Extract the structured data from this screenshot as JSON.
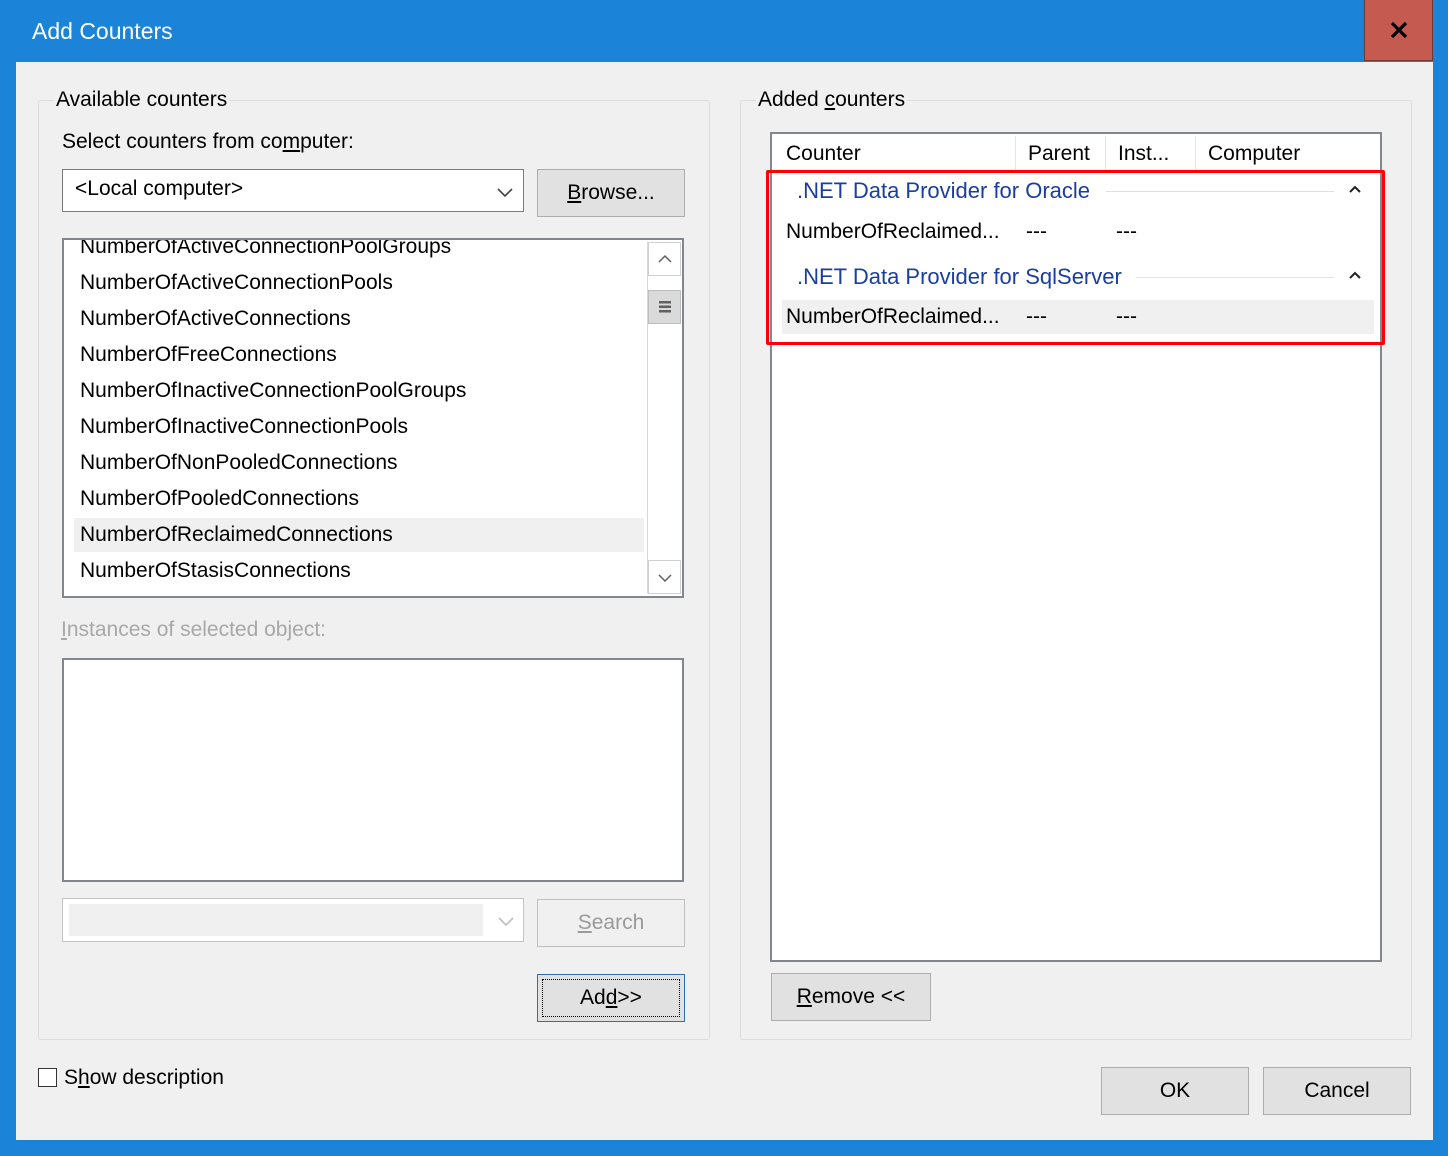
{
  "window": {
    "title": "Add Counters",
    "close_icon": "close-x-icon"
  },
  "available": {
    "group_label": "Available counters",
    "computer_label_parts": [
      "Select counters from co",
      "m",
      "puter:"
    ],
    "computer_value": "<Local computer>",
    "browse_label_parts": [
      "",
      "B",
      "rowse..."
    ],
    "counters": [
      "NumberOfActiveConnectionPoolGroups",
      "NumberOfActiveConnectionPools",
      "NumberOfActiveConnections",
      "NumberOfFreeConnections",
      "NumberOfInactiveConnectionPoolGroups",
      "NumberOfInactiveConnectionPools",
      "NumberOfNonPooledConnections",
      "NumberOfPooledConnections",
      "NumberOfReclaimedConnections",
      "NumberOfStasisConnections"
    ],
    "selected_counter": "NumberOfReclaimedConnections",
    "instances_label_parts": [
      "",
      "I",
      "nstances of selected object:"
    ],
    "instances": [],
    "search_value": "",
    "search_label_parts": [
      "",
      "S",
      "earch"
    ],
    "add_label_parts": [
      "Ad",
      "d",
      " >>"
    ]
  },
  "added": {
    "group_label_parts": [
      "Added ",
      "c",
      "ounters"
    ],
    "columns": [
      "Counter",
      "Parent",
      "Inst...",
      "Computer"
    ],
    "groups": [
      {
        "name": ".NET Data Provider for Oracle",
        "rows": [
          {
            "counter": "NumberOfReclaimed...",
            "parent": "---",
            "instance": "---",
            "computer": ""
          }
        ]
      },
      {
        "name": ".NET Data Provider for SqlServer",
        "rows": [
          {
            "counter": "NumberOfReclaimed...",
            "parent": "---",
            "instance": "---",
            "computer": ""
          }
        ]
      }
    ],
    "remove_label_parts": [
      "",
      "R",
      "emove <<"
    ]
  },
  "footer": {
    "show_description_parts": [
      "S",
      "h",
      "ow description"
    ],
    "show_description_checked": false,
    "ok_label": "OK",
    "cancel_label": "Cancel"
  },
  "colors": {
    "titlebar": "#1c84d8",
    "close_button": "#c55a50",
    "group_header_text": "#1a3ea0",
    "highlight_box": "#ff0000"
  }
}
